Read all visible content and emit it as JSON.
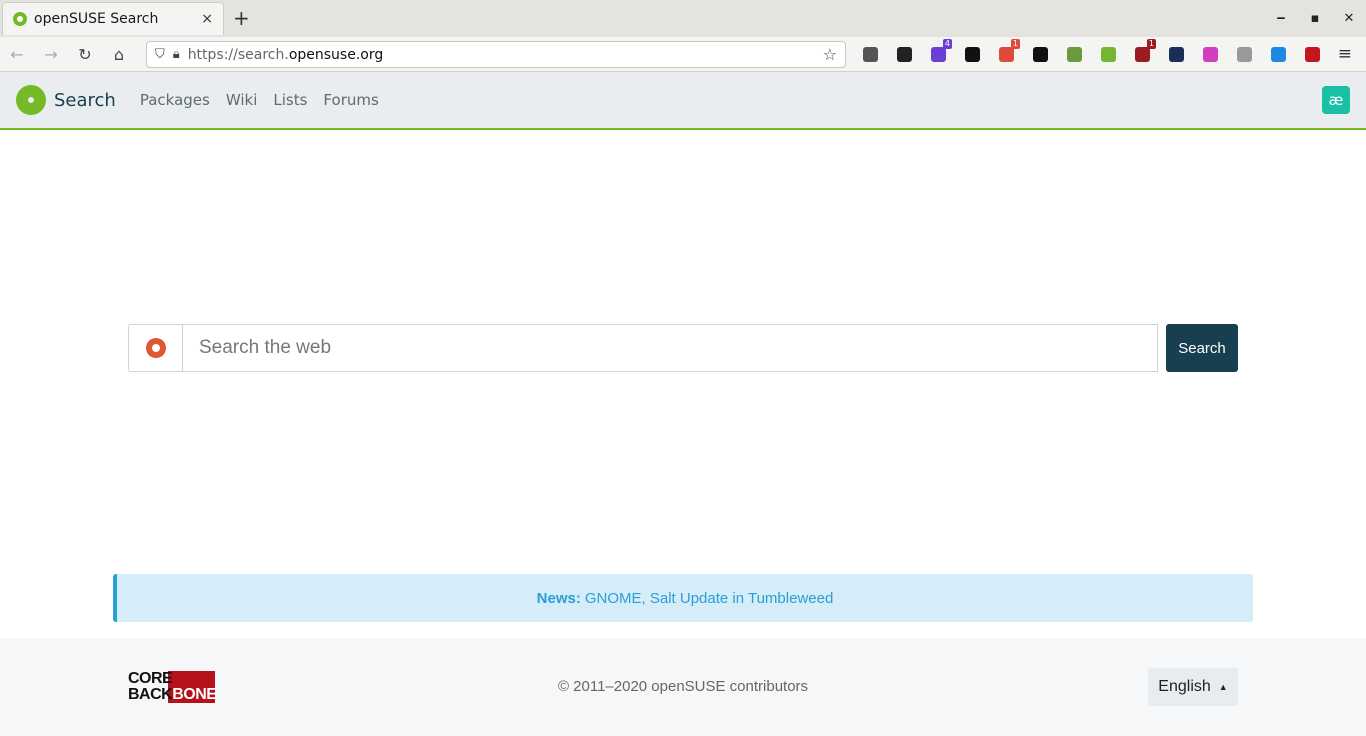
{
  "browser": {
    "tab_title": "openSUSE Search",
    "tab_close": "×",
    "new_tab": "+",
    "window_controls": {
      "minimize": "‒",
      "maximize": "▪",
      "close": "✕"
    },
    "nav": {
      "back": "←",
      "forward": "→",
      "reload": "↻",
      "home": "⌂"
    },
    "url_prefix": "https://search.",
    "url_domain": "opensuse.org",
    "bookmark_star": "☆",
    "menu": "≡",
    "extensions": [
      {
        "name": "pocket",
        "color": "#555555",
        "badge": ""
      },
      {
        "name": "duckduckgo-privacy",
        "color": "#222222",
        "badge": ""
      },
      {
        "name": "stack",
        "color": "#6a3fd6",
        "badge": "4"
      },
      {
        "name": "ae",
        "color": "#111111",
        "badge": ""
      },
      {
        "name": "gmail",
        "color": "#e04a3a",
        "badge": "1"
      },
      {
        "name": "gnome",
        "color": "#111111",
        "badge": ""
      },
      {
        "name": "user-agent",
        "color": "#6a9b3b",
        "badge": ""
      },
      {
        "name": "download",
        "color": "#74b633",
        "badge": ""
      },
      {
        "name": "ublock",
        "color": "#9b1b20",
        "badge": "1"
      },
      {
        "name": "container",
        "color": "#1d2d5a",
        "badge": ""
      },
      {
        "name": "colorful",
        "color": "#d33dc0",
        "badge": ""
      },
      {
        "name": "power",
        "color": "#999999",
        "badge": ""
      },
      {
        "name": "shield",
        "color": "#1e88e5",
        "badge": ""
      },
      {
        "name": "youtube",
        "color": "#c4161c",
        "badge": ""
      }
    ]
  },
  "header": {
    "brand": "Search",
    "nav": [
      "Packages",
      "Wiki",
      "Lists",
      "Forums"
    ],
    "user_icon": "æ"
  },
  "search": {
    "placeholder": "Search the web",
    "button": "Search",
    "engine_icon": "duckduckgo-icon"
  },
  "news": {
    "label": "News:",
    "link": "GNOME, Salt Update in Tumbleweed"
  },
  "footer": {
    "logo_line1": "CORE",
    "logo_line2_a": "BACK",
    "logo_line2_b": "BONE",
    "copyright": "© 2011–2020 openSUSE contributors",
    "language": "English",
    "language_caret": "▲"
  }
}
